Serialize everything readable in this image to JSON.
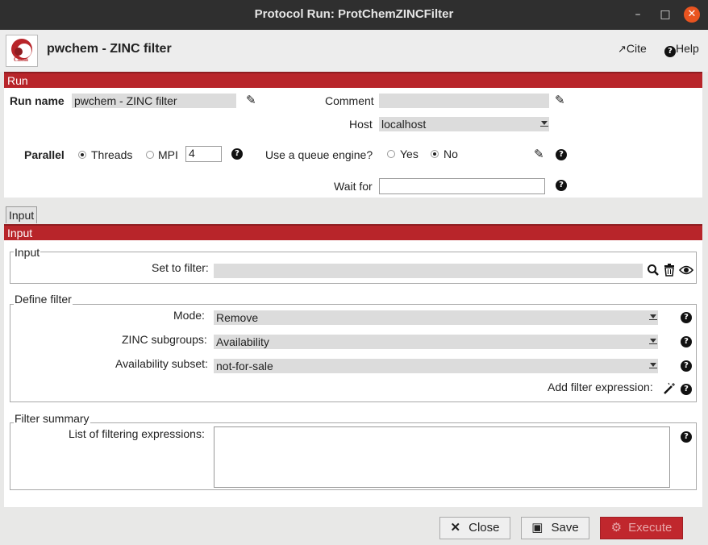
{
  "window": {
    "title": "Protocol Run: ProtChemZINCFilter",
    "minimize": "–",
    "maximize": "□",
    "close": "✕"
  },
  "header": {
    "logo_text": "Chem",
    "title": "pwchem - ZINC filter",
    "cite": "Cite",
    "help": "Help"
  },
  "run": {
    "section_label": "Run",
    "run_name_label": "Run name",
    "run_name_value": "pwchem - ZINC filter",
    "comment_label": "Comment",
    "comment_value": "",
    "host_label": "Host",
    "host_value": "localhost",
    "parallel_label": "Parallel",
    "threads_label": "Threads",
    "mpi_label": "MPI",
    "threads_value": "4",
    "threads_selected": true,
    "queue_label": "Use a queue engine?",
    "queue_yes": "Yes",
    "queue_no": "No",
    "queue_selected": "No",
    "wait_for_label": "Wait for",
    "wait_for_value": ""
  },
  "tabs": [
    {
      "label": "Input"
    }
  ],
  "input": {
    "section_label": "Input",
    "group_input_title": "Input",
    "set_to_filter_label": "Set to filter:",
    "set_to_filter_value": "",
    "group_define_title": "Define filter",
    "mode_label": "Mode:",
    "mode_value": "Remove",
    "subgroups_label": "ZINC subgroups:",
    "subgroups_value": "Availability",
    "availability_label": "Availability subset:",
    "availability_value": "not-for-sale",
    "add_expr_label": "Add filter expression:",
    "group_summary_title": "Filter summary",
    "list_label": "List of filtering expressions:",
    "list_value": ""
  },
  "footer": {
    "close": "Close",
    "save": "Save",
    "execute": "Execute"
  },
  "colors": {
    "accent": "#b8252a",
    "titlebar": "#2f2f2f",
    "close_window": "#e95420"
  }
}
